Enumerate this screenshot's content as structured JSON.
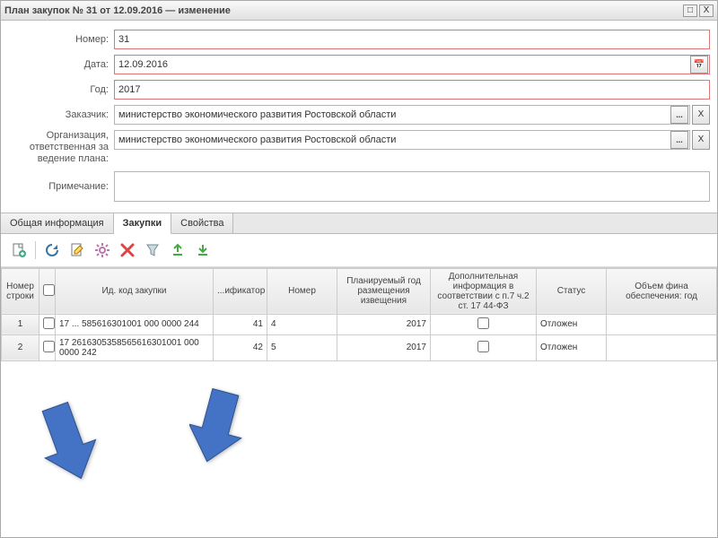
{
  "window": {
    "title": "План закупок № 31 от 12.09.2016 — изменение"
  },
  "form": {
    "labels": {
      "number": "Номер:",
      "date": "Дата:",
      "year": "Год:",
      "customer": "Заказчик:",
      "org": "Организация, ответственная за ведение плана:",
      "note": "Примечание:"
    },
    "values": {
      "number": "31",
      "date": "12.09.2016",
      "year": "2017",
      "customer": "министерство экономического развития Ростовской области",
      "org": "министерство экономического развития Ростовской области",
      "note": ""
    }
  },
  "tabs": [
    {
      "label": "Общая информация",
      "active": false
    },
    {
      "label": "Закупки",
      "active": true
    },
    {
      "label": "Свойства",
      "active": false
    }
  ],
  "grid": {
    "headers": {
      "row_num": "Номер строки",
      "id_code": "Ид. код закупки",
      "classifier": "...ификатор",
      "number": "Номер",
      "planned_year": "Планируемый год размещения извещения",
      "addl_info": "Дополнительная информация в соответствии с п.7 ч.2 ст. 17 44-ФЗ",
      "status": "Статус",
      "funding": "Объем фина обеспечения: год"
    },
    "rows": [
      {
        "num": "1",
        "id_code": "17 ... 585616301001 000 0000 244",
        "classifier": "41",
        "number": "4",
        "year": "2017",
        "addl": "",
        "status": "Отложен",
        "funding": ""
      },
      {
        "num": "2",
        "id_code": "17 2616305358565616301001 000 0000 242",
        "classifier": "42",
        "number": "5",
        "year": "2017",
        "addl": "",
        "status": "Отложен",
        "funding": ""
      }
    ]
  }
}
